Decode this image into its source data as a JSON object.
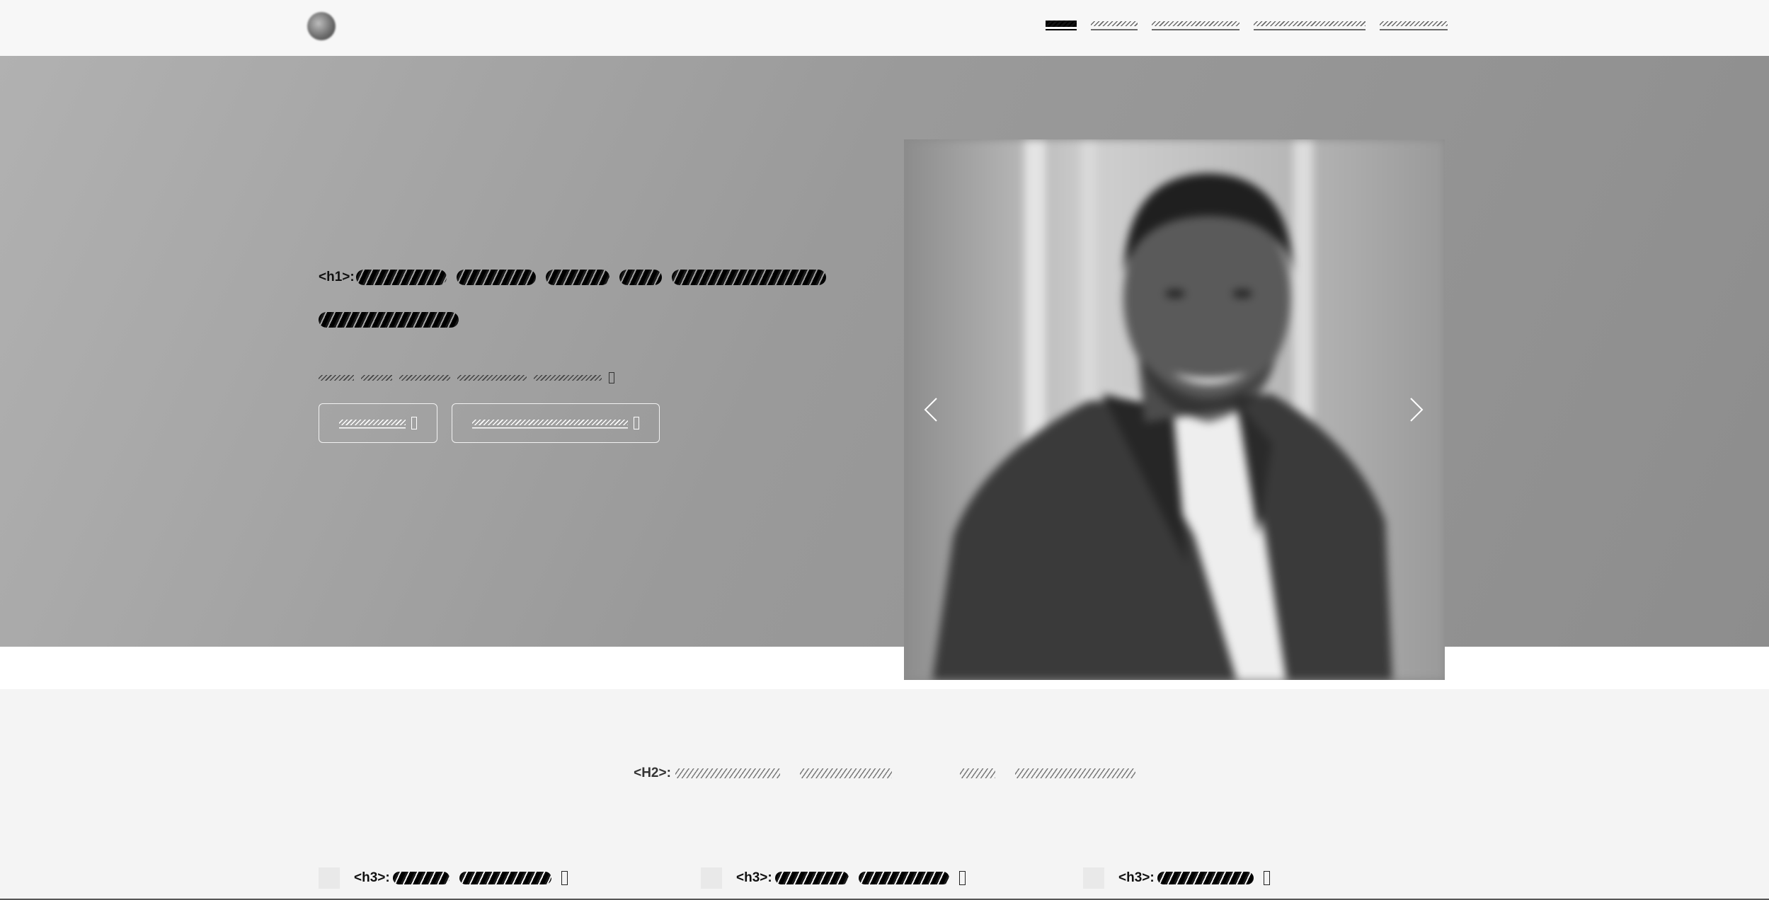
{
  "header": {
    "logo": {
      "icon": "avatar-logo"
    },
    "nav": [
      {
        "label": "Home",
        "active": true
      },
      {
        "label": "About"
      },
      {
        "label": "Services"
      },
      {
        "label": "Testimonials"
      },
      {
        "label": "Contact"
      }
    ]
  },
  "hero": {
    "h1_tag": "<h1>:",
    "tagline_icon": "external-link-icon",
    "buttons": [
      {
        "icon": "external-link-icon"
      },
      {
        "icon": "external-link-icon"
      }
    ],
    "carousel": {
      "prev_icon": "chevron-left-icon",
      "next_icon": "chevron-right-icon",
      "slide_icon": "portrait-photo"
    }
  },
  "section": {
    "h2_tag": "<H2>:",
    "features": [
      {
        "tag": "<h3>:",
        "icon": "feature-icon"
      },
      {
        "tag": "<h3>:",
        "icon": "feature-icon"
      },
      {
        "tag": "<h3>:",
        "icon": "feature-icon"
      }
    ]
  },
  "colors": {
    "header_bg": "#f7f7f7",
    "hero_bg": "#9a9a9a",
    "section_bg": "#f4f4f4",
    "button_border": "#f2f2f2"
  }
}
